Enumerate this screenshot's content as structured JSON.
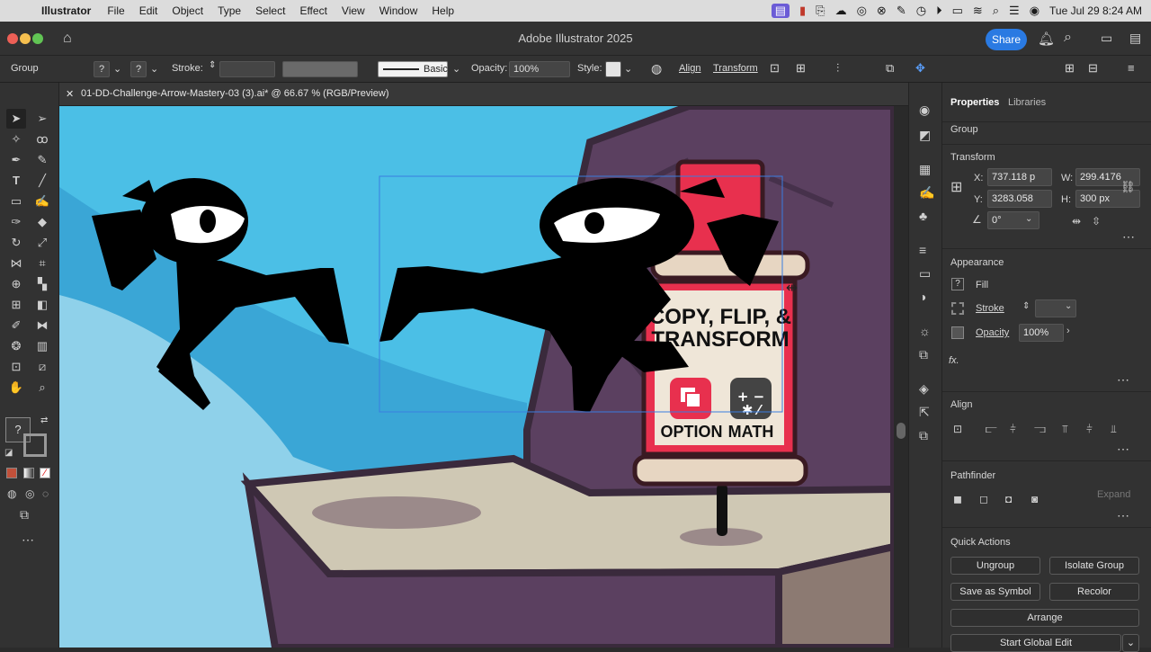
{
  "menubar": {
    "app": "Illustrator",
    "items": [
      "File",
      "Edit",
      "Object",
      "Type",
      "Select",
      "Effect",
      "View",
      "Window",
      "Help"
    ],
    "clock": "Tue Jul 29  8:24 AM"
  },
  "window": {
    "title": "Adobe Illustrator 2025",
    "share": "Share"
  },
  "control": {
    "selection_type": "Group",
    "stroke_label": "Stroke:",
    "brush": "Basic",
    "opacity_label": "Opacity:",
    "opacity_value": "100%",
    "style_label": "Style:",
    "align_link": "Align",
    "transform_link": "Transform"
  },
  "document": {
    "tab": "01-DD-Challenge-Arrow-Mastery-03 (3).ai* @ 66.67 % (RGB/Preview)"
  },
  "artwork": {
    "sign_line1": "COPY, FLIP, &",
    "sign_line2": "TRANSFORM",
    "key1": "OPTION",
    "key2": "MATH"
  },
  "colors": {
    "accent": "#2a7ae2",
    "sky": "#4bbfe6",
    "rock": "#5b4060",
    "sign_red": "#e8304e"
  },
  "panel": {
    "tabs": [
      "Properties",
      "Libraries"
    ],
    "object_type": "Group",
    "transform": {
      "title": "Transform",
      "x_label": "X:",
      "x_value": "737.118 p",
      "y_label": "Y:",
      "y_value": "3283.058",
      "w_label": "W:",
      "w_value": "299.4176",
      "h_label": "H:",
      "h_value": "300 px",
      "angle_value": "0°"
    },
    "appearance": {
      "title": "Appearance",
      "fill": "Fill",
      "stroke": "Stroke",
      "opacity": "Opacity",
      "opacity_value": "100%",
      "fx": "fx."
    },
    "align_title": "Align",
    "pathfinder": {
      "title": "Pathfinder",
      "expand": "Expand"
    },
    "quick_actions": {
      "title": "Quick Actions",
      "ungroup": "Ungroup",
      "isolate": "Isolate Group",
      "save_symbol": "Save as Symbol",
      "recolor": "Recolor",
      "arrange": "Arrange",
      "global_edit": "Start Global Edit"
    }
  }
}
